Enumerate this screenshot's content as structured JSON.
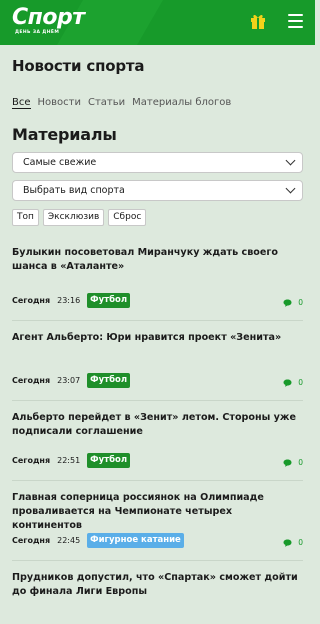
{
  "header": {
    "logo": "Спорт",
    "logo_tagline": "ДЕНЬ ЗА ДНЁМ",
    "gift_icon": "gift-icon",
    "menu_icon": "hamburger-menu-icon",
    "brand_color": "#179a2a"
  },
  "news": {
    "title": "Новости спорта",
    "tabs": [
      {
        "label": "Все",
        "active": true
      },
      {
        "label": "Новости",
        "active": false
      },
      {
        "label": "Статьи",
        "active": false
      },
      {
        "label": "Материалы блогов",
        "active": false
      }
    ]
  },
  "materials": {
    "title": "Материалы",
    "sort_select": "Самые свежие",
    "sport_select": "Выбрать вид спорта",
    "filters": [
      "Топ",
      "Эксклюзив",
      "Сброс"
    ]
  },
  "articles": [
    {
      "title": "Булыкин посоветовал Миранчуку ждать своего шанса в «Аталанте»",
      "day": "Сегодня",
      "time": "23:16",
      "tag": "Футбол",
      "tag_color": "#1f8f2a",
      "comments": "0"
    },
    {
      "title": "Агент Альберто: Юри нравится проект «Зенита»",
      "day": "Сегодня",
      "time": "23:07",
      "tag": "Футбол",
      "tag_color": "#1f8f2a",
      "comments": "0"
    },
    {
      "title": "Альберто перейдет в «Зенит» летом. Стороны уже подписали соглашение",
      "day": "Сегодня",
      "time": "22:51",
      "tag": "Футбол",
      "tag_color": "#1f8f2a",
      "comments": "0"
    },
    {
      "title": "Главная соперница россиянок на Олимпиаде проваливается на Чемпионате четырех континентов",
      "day": "Сегодня",
      "time": "22:45",
      "tag": "Фигурное катание",
      "tag_color": "#5aaee8",
      "comments": "0"
    },
    {
      "title": "Прудников допустил, что «Спартак» сможет дойти до финала Лиги Европы"
    }
  ]
}
